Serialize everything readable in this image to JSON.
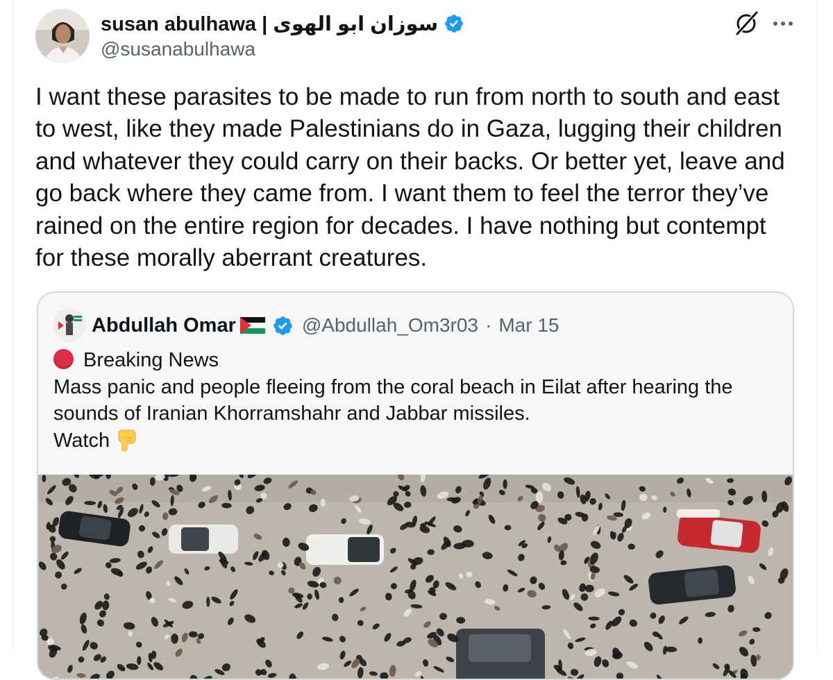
{
  "author": {
    "display_name": "susan abulhawa | سوزان ابو الهوى",
    "handle": "@susanabulhawa",
    "verified_icon": "verified-badge-icon"
  },
  "header_actions": {
    "grok_icon": "grok-icon",
    "more_icon": "more-icon"
  },
  "tweet": {
    "text": "I want these parasites to be made to run from north to south and east to west, like they made Palestinians do in Gaza, lugging their children and whatever they could carry on their backs. Or better yet, leave and go back where they came from. I want them to feel the terror they’ve rained on the entire region for decades. I have nothing but contempt for these morally aberrant creatures."
  },
  "quote": {
    "display_name": "Abdullah Omar",
    "flag_icon": "palestine-flag-icon",
    "handle": "@Abdullah_Om3r03",
    "separator": "·",
    "date": "Mar 15",
    "headline": "Breaking News",
    "body_line1": "Mass panic and people fleeing from the coral beach in Eilat after hearing the",
    "body_line2": "sounds of Iranian Khorramshahr and Jabbar missiles.",
    "watch_label": "Watch",
    "watch_icon": "pointing-down-icon",
    "media": "aerial-crowd-video-thumbnail"
  },
  "colors": {
    "verified_blue": "#1d9bf0",
    "secondary_text": "#536471",
    "border": "#cfd9de",
    "red_circle": "#dd2e44"
  }
}
